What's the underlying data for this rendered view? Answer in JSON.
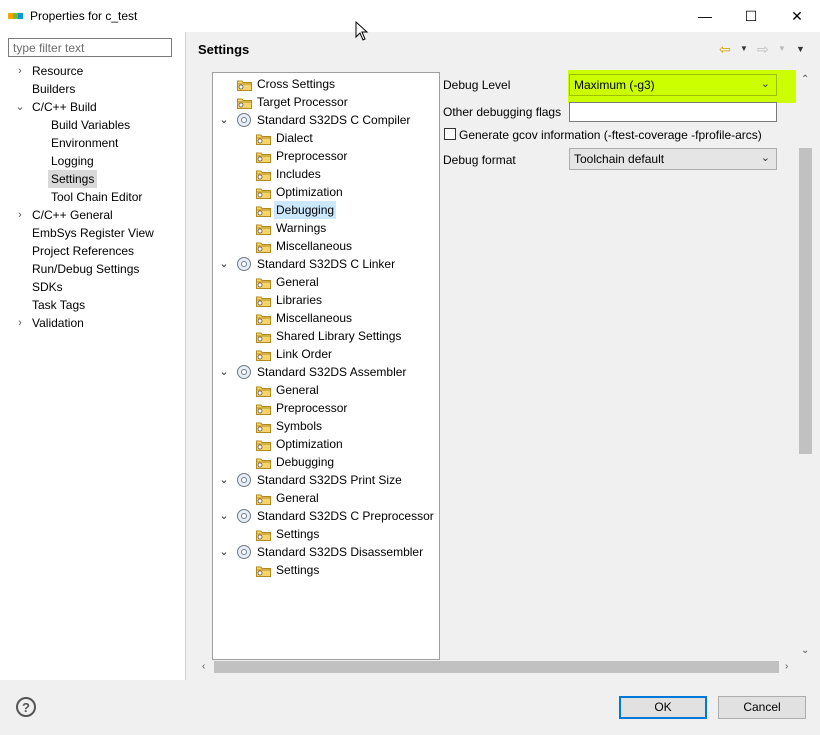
{
  "window": {
    "title": "Properties for c_test",
    "minimize_glyph": "—",
    "maximize_glyph": "☐",
    "close_glyph": "✕"
  },
  "filter": {
    "placeholder": "type filter text"
  },
  "nav": {
    "items": [
      {
        "label": "Resource",
        "expander": "›"
      },
      {
        "label": "Builders",
        "expander": ""
      },
      {
        "label": "C/C++ Build",
        "expander": "⌄"
      },
      {
        "label": "Build Variables",
        "expander": ""
      },
      {
        "label": "Environment",
        "expander": ""
      },
      {
        "label": "Logging",
        "expander": ""
      },
      {
        "label": "Settings",
        "expander": ""
      },
      {
        "label": "Tool Chain Editor",
        "expander": ""
      },
      {
        "label": "C/C++ General",
        "expander": "›"
      },
      {
        "label": "EmbSys Register View",
        "expander": ""
      },
      {
        "label": "Project References",
        "expander": ""
      },
      {
        "label": "Run/Debug Settings",
        "expander": ""
      },
      {
        "label": "SDKs",
        "expander": ""
      },
      {
        "label": "Task Tags",
        "expander": ""
      },
      {
        "label": "Validation",
        "expander": "›"
      }
    ],
    "selected": "Settings"
  },
  "header": {
    "title": "Settings",
    "back_icon": "⇦",
    "forward_icon": "⇨",
    "menu_icon": "▼"
  },
  "tree": {
    "items": [
      {
        "label": "Cross Settings",
        "icon": "folder-icon"
      },
      {
        "label": "Target Processor",
        "icon": "folder-icon"
      },
      {
        "label": "Standard S32DS C Compiler",
        "icon": "tool-icon",
        "expander": "⌄"
      },
      {
        "label": "Dialect",
        "icon": "folder-icon"
      },
      {
        "label": "Preprocessor",
        "icon": "folder-icon"
      },
      {
        "label": "Includes",
        "icon": "folder-icon"
      },
      {
        "label": "Optimization",
        "icon": "folder-icon"
      },
      {
        "label": "Debugging",
        "icon": "folder-icon"
      },
      {
        "label": "Warnings",
        "icon": "folder-icon"
      },
      {
        "label": "Miscellaneous",
        "icon": "folder-icon"
      },
      {
        "label": "Standard S32DS C Linker",
        "icon": "tool-icon",
        "expander": "⌄"
      },
      {
        "label": "General",
        "icon": "folder-icon"
      },
      {
        "label": "Libraries",
        "icon": "folder-icon"
      },
      {
        "label": "Miscellaneous",
        "icon": "folder-icon"
      },
      {
        "label": "Shared Library Settings",
        "icon": "folder-icon"
      },
      {
        "label": "Link Order",
        "icon": "folder-icon"
      },
      {
        "label": "Standard S32DS Assembler",
        "icon": "tool-icon",
        "expander": "⌄"
      },
      {
        "label": "General",
        "icon": "folder-icon"
      },
      {
        "label": "Preprocessor",
        "icon": "folder-icon"
      },
      {
        "label": "Symbols",
        "icon": "folder-icon"
      },
      {
        "label": "Optimization",
        "icon": "folder-icon"
      },
      {
        "label": "Debugging",
        "icon": "folder-icon"
      },
      {
        "label": "Standard S32DS Print Size",
        "icon": "tool-icon",
        "expander": "⌄"
      },
      {
        "label": "General",
        "icon": "folder-icon"
      },
      {
        "label": "Standard S32DS C Preprocessor",
        "icon": "tool-icon",
        "expander": "⌄"
      },
      {
        "label": "Settings",
        "icon": "folder-icon"
      },
      {
        "label": "Standard S32DS Disassembler",
        "icon": "tool-icon",
        "expander": "⌄"
      },
      {
        "label": "Settings",
        "icon": "folder-icon"
      }
    ],
    "selected_label": "Debugging"
  },
  "form": {
    "debug_level_label": "Debug Level",
    "debug_level_value": "Maximum (-g3)",
    "other_flags_label": "Other debugging flags",
    "other_flags_value": "",
    "gcov_label": "Generate gcov information (-ftest-coverage -fprofile-arcs)",
    "gcov_checked": false,
    "debug_format_label": "Debug format",
    "debug_format_value": "Toolchain default",
    "highlight_color": "#ccff00"
  },
  "footer": {
    "help_glyph": "?",
    "ok_label": "OK",
    "cancel_label": "Cancel"
  }
}
